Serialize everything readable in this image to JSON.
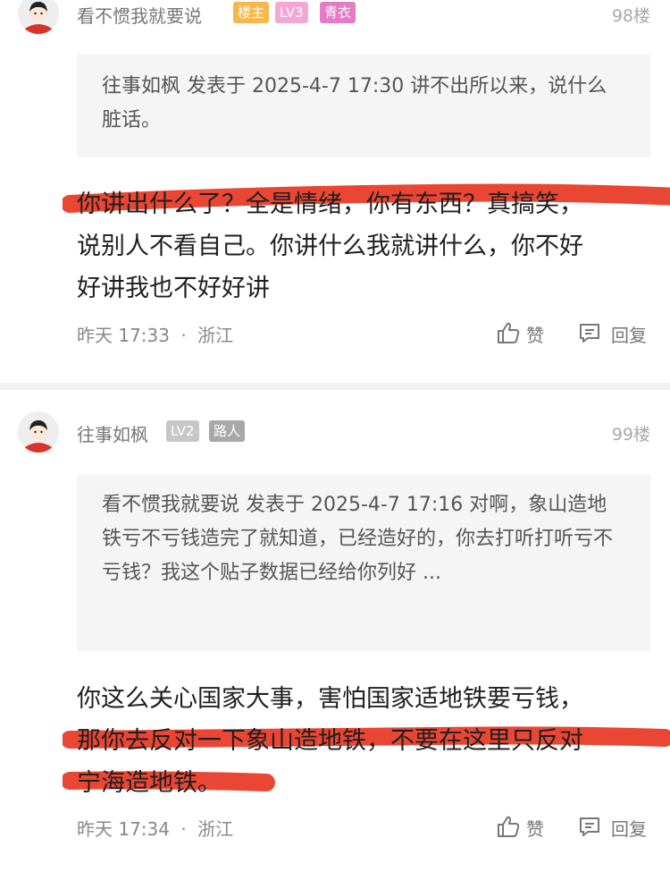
{
  "posts": [
    {
      "username": "看不惯我就要说",
      "badges": [
        {
          "label": "楼主",
          "color": "#f5b84a"
        },
        {
          "label": "LV3",
          "color": "#f4a7d4"
        },
        {
          "label": "青衣",
          "color": "#e57bc4"
        }
      ],
      "floor": "98楼",
      "quote": "往事如枫 发表于 2025-4-7 17:30 讲不出所以来，说什么脏话。",
      "body_lines": [
        "你讲出什么了？全是情绪，你有东西？真搞笑，",
        "说别人不看自己。你讲什么我就讲什么，你不好",
        "好讲我也不好好讲"
      ],
      "time": "昨天 17:33",
      "location": "浙江",
      "like_label": "赞",
      "reply_label": "回复"
    },
    {
      "username": "往事如枫",
      "badges": [
        {
          "label": "LV2",
          "color": "#c7c7c7"
        },
        {
          "label": "路人",
          "color": "#a8a8a8"
        }
      ],
      "floor": "99楼",
      "quote": "看不惯我就要说 发表于 2025-4-7 17:16 对啊，象山造地铁亏不亏钱造完了就知道，已经造好的，你去打听打听亏不亏钱？我这个贴子数据已经给你列好 ...",
      "body_lines": [
        "你这么关心国家大事，害怕国家适地铁要亏钱，",
        "那你去反对一下象山造地铁，不要在这里只反对",
        "宁海造地铁。"
      ],
      "time": "昨天 17:34",
      "location": "浙江",
      "like_label": "赞",
      "reply_label": "回复"
    }
  ],
  "meta_separator": "·",
  "highlight_color": "#e8321e"
}
